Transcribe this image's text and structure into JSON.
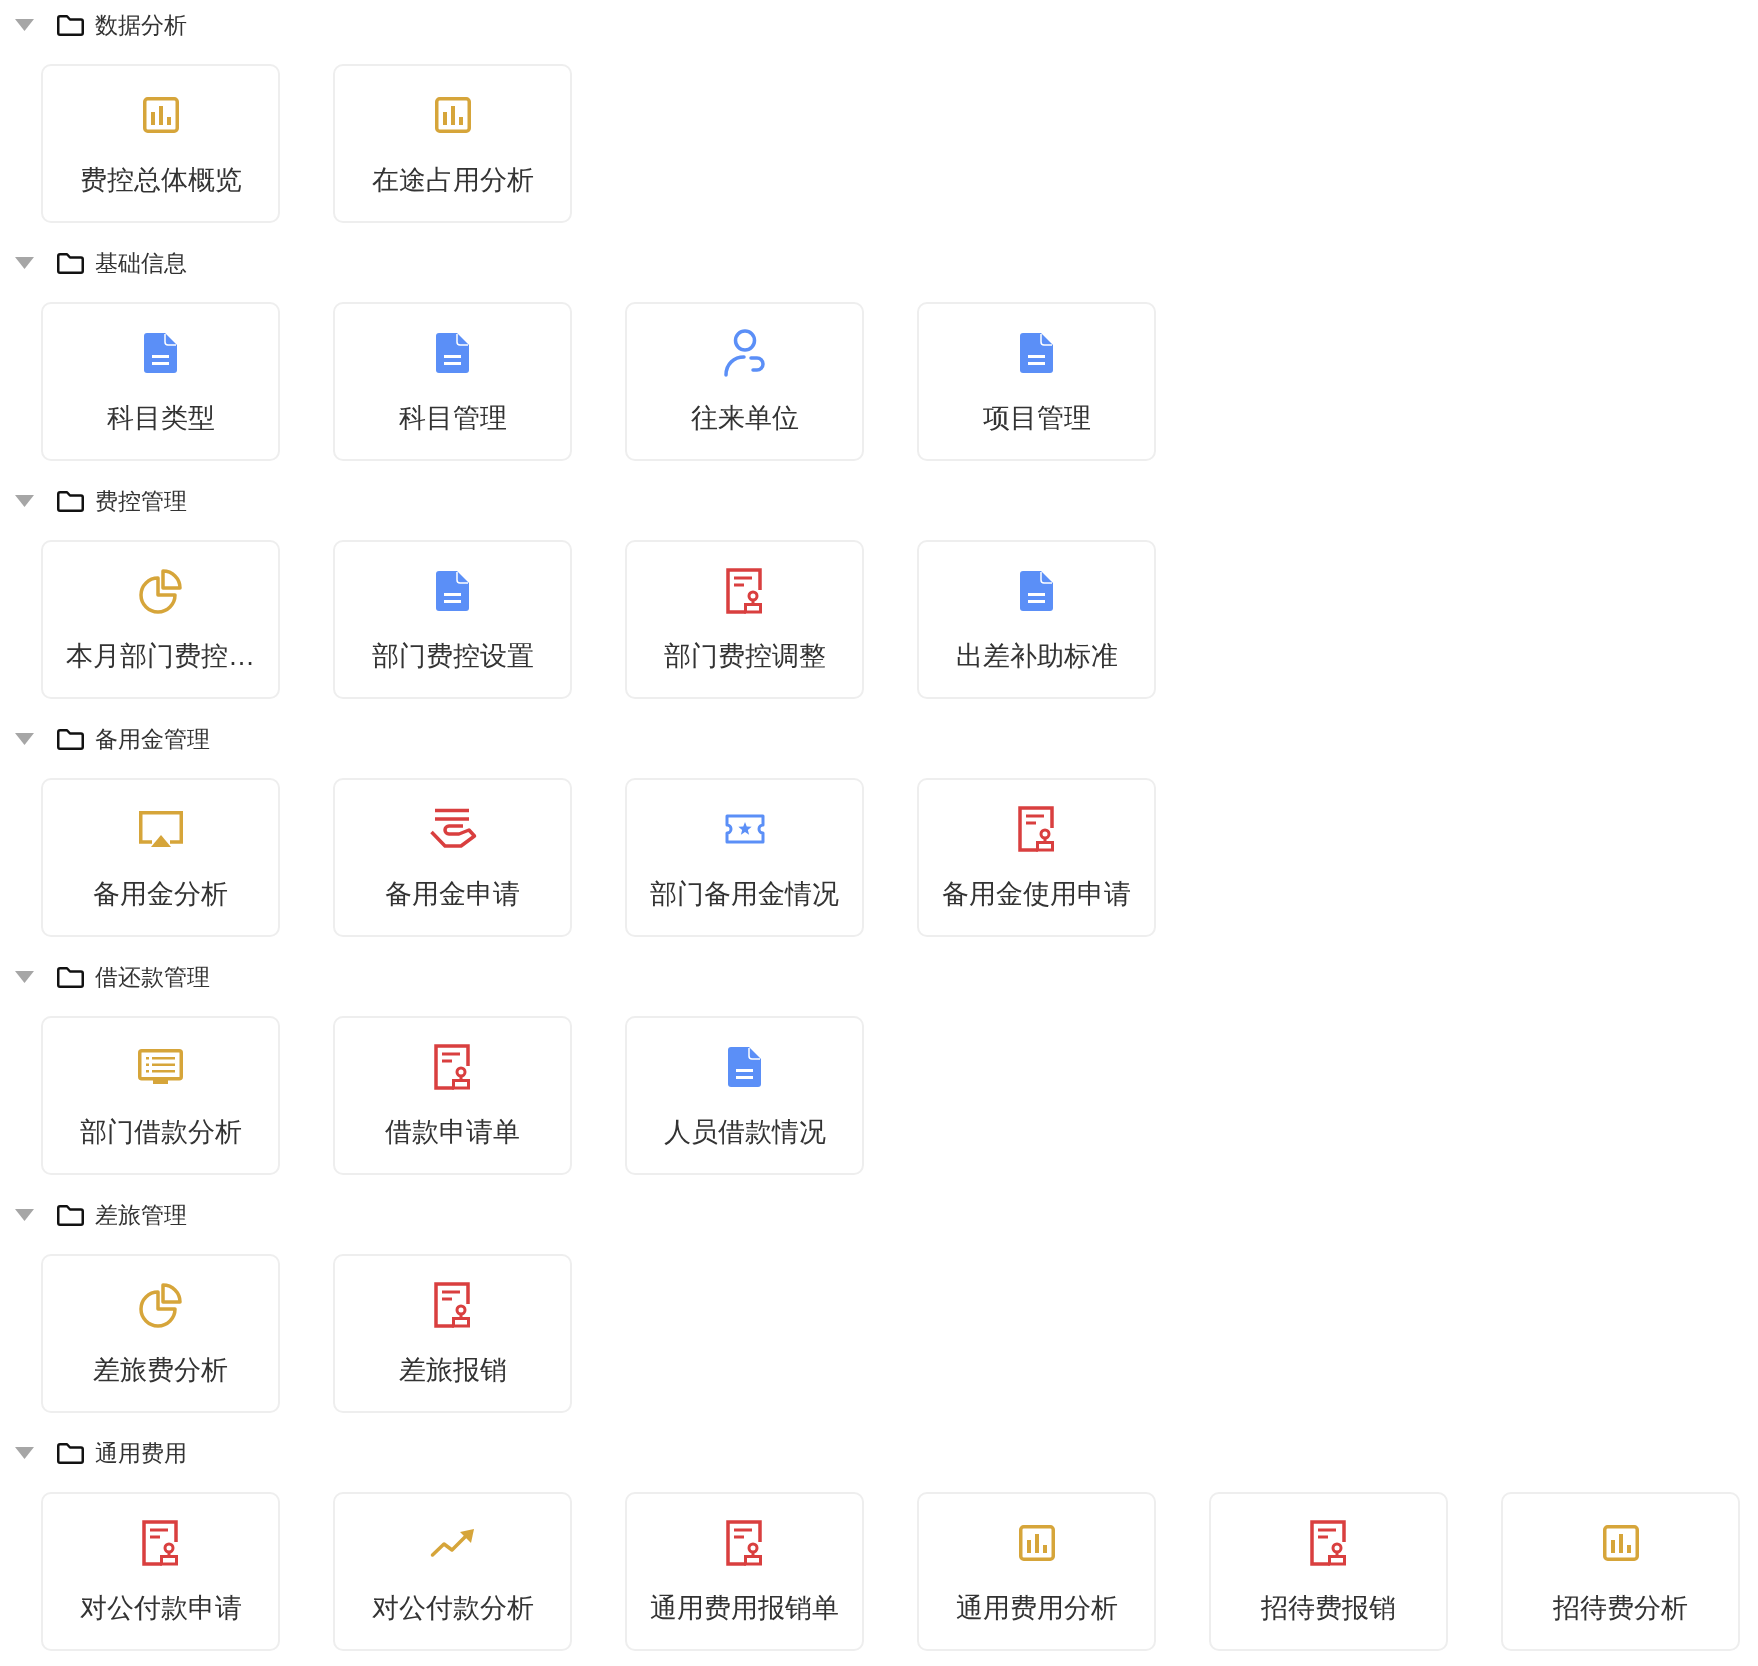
{
  "sections": [
    {
      "title": "数据分析",
      "expanded": true,
      "items": [
        {
          "label": "费控总体概览",
          "kind": "chart"
        },
        {
          "label": "在途占用分析",
          "kind": "chart"
        }
      ]
    },
    {
      "title": "基础信息",
      "expanded": true,
      "items": [
        {
          "label": "科目类型",
          "kind": "document"
        },
        {
          "label": "科目管理",
          "kind": "document"
        },
        {
          "label": "往来单位",
          "kind": "contact"
        },
        {
          "label": "项目管理",
          "kind": "document"
        }
      ]
    },
    {
      "title": "费控管理",
      "expanded": true,
      "items": [
        {
          "label": "本月部门费控…",
          "kind": "pie"
        },
        {
          "label": "部门费控设置",
          "kind": "document"
        },
        {
          "label": "部门费控调整",
          "kind": "stamp"
        },
        {
          "label": "出差补助标准",
          "kind": "document"
        }
      ]
    },
    {
      "title": "备用金管理",
      "expanded": true,
      "items": [
        {
          "label": "备用金分析",
          "kind": "screen"
        },
        {
          "label": "备用金申请",
          "kind": "hand"
        },
        {
          "label": "部门备用金情况",
          "kind": "ticket"
        },
        {
          "label": "备用金使用申请",
          "kind": "stamp"
        }
      ]
    },
    {
      "title": "借还款管理",
      "expanded": true,
      "items": [
        {
          "label": "部门借款分析",
          "kind": "list"
        },
        {
          "label": "借款申请单",
          "kind": "stamp"
        },
        {
          "label": "人员借款情况",
          "kind": "document"
        }
      ]
    },
    {
      "title": "差旅管理",
      "expanded": true,
      "items": [
        {
          "label": "差旅费分析",
          "kind": "pie"
        },
        {
          "label": "差旅报销",
          "kind": "stamp"
        }
      ]
    },
    {
      "title": "通用费用",
      "expanded": true,
      "items": [
        {
          "label": "对公付款申请",
          "kind": "stamp"
        },
        {
          "label": "对公付款分析",
          "kind": "trend"
        },
        {
          "label": "通用费用报销单",
          "kind": "stamp"
        },
        {
          "label": "通用费用分析",
          "kind": "chart"
        },
        {
          "label": "招待费报销",
          "kind": "stamp"
        },
        {
          "label": "招待费分析",
          "kind": "chart"
        }
      ]
    }
  ]
}
